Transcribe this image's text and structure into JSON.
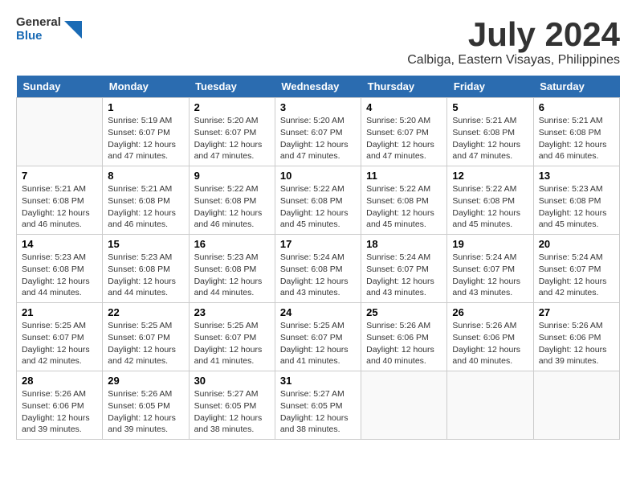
{
  "header": {
    "logo_general": "General",
    "logo_blue": "Blue",
    "month_year": "July 2024",
    "location": "Calbiga, Eastern Visayas, Philippines"
  },
  "days": [
    "Sunday",
    "Monday",
    "Tuesday",
    "Wednesday",
    "Thursday",
    "Friday",
    "Saturday"
  ],
  "weeks": [
    [
      {
        "date": "",
        "info": ""
      },
      {
        "date": "1",
        "info": "Sunrise: 5:19 AM\nSunset: 6:07 PM\nDaylight: 12 hours and 47 minutes."
      },
      {
        "date": "2",
        "info": "Sunrise: 5:20 AM\nSunset: 6:07 PM\nDaylight: 12 hours and 47 minutes."
      },
      {
        "date": "3",
        "info": "Sunrise: 5:20 AM\nSunset: 6:07 PM\nDaylight: 12 hours and 47 minutes."
      },
      {
        "date": "4",
        "info": "Sunrise: 5:20 AM\nSunset: 6:07 PM\nDaylight: 12 hours and 47 minutes."
      },
      {
        "date": "5",
        "info": "Sunrise: 5:21 AM\nSunset: 6:08 PM\nDaylight: 12 hours and 47 minutes."
      },
      {
        "date": "6",
        "info": "Sunrise: 5:21 AM\nSunset: 6:08 PM\nDaylight: 12 hours and 46 minutes."
      }
    ],
    [
      {
        "date": "7",
        "info": "Sunrise: 5:21 AM\nSunset: 6:08 PM\nDaylight: 12 hours and 46 minutes."
      },
      {
        "date": "8",
        "info": "Sunrise: 5:21 AM\nSunset: 6:08 PM\nDaylight: 12 hours and 46 minutes."
      },
      {
        "date": "9",
        "info": "Sunrise: 5:22 AM\nSunset: 6:08 PM\nDaylight: 12 hours and 46 minutes."
      },
      {
        "date": "10",
        "info": "Sunrise: 5:22 AM\nSunset: 6:08 PM\nDaylight: 12 hours and 45 minutes."
      },
      {
        "date": "11",
        "info": "Sunrise: 5:22 AM\nSunset: 6:08 PM\nDaylight: 12 hours and 45 minutes."
      },
      {
        "date": "12",
        "info": "Sunrise: 5:22 AM\nSunset: 6:08 PM\nDaylight: 12 hours and 45 minutes."
      },
      {
        "date": "13",
        "info": "Sunrise: 5:23 AM\nSunset: 6:08 PM\nDaylight: 12 hours and 45 minutes."
      }
    ],
    [
      {
        "date": "14",
        "info": "Sunrise: 5:23 AM\nSunset: 6:08 PM\nDaylight: 12 hours and 44 minutes."
      },
      {
        "date": "15",
        "info": "Sunrise: 5:23 AM\nSunset: 6:08 PM\nDaylight: 12 hours and 44 minutes."
      },
      {
        "date": "16",
        "info": "Sunrise: 5:23 AM\nSunset: 6:08 PM\nDaylight: 12 hours and 44 minutes."
      },
      {
        "date": "17",
        "info": "Sunrise: 5:24 AM\nSunset: 6:08 PM\nDaylight: 12 hours and 43 minutes."
      },
      {
        "date": "18",
        "info": "Sunrise: 5:24 AM\nSunset: 6:07 PM\nDaylight: 12 hours and 43 minutes."
      },
      {
        "date": "19",
        "info": "Sunrise: 5:24 AM\nSunset: 6:07 PM\nDaylight: 12 hours and 43 minutes."
      },
      {
        "date": "20",
        "info": "Sunrise: 5:24 AM\nSunset: 6:07 PM\nDaylight: 12 hours and 42 minutes."
      }
    ],
    [
      {
        "date": "21",
        "info": "Sunrise: 5:25 AM\nSunset: 6:07 PM\nDaylight: 12 hours and 42 minutes."
      },
      {
        "date": "22",
        "info": "Sunrise: 5:25 AM\nSunset: 6:07 PM\nDaylight: 12 hours and 42 minutes."
      },
      {
        "date": "23",
        "info": "Sunrise: 5:25 AM\nSunset: 6:07 PM\nDaylight: 12 hours and 41 minutes."
      },
      {
        "date": "24",
        "info": "Sunrise: 5:25 AM\nSunset: 6:07 PM\nDaylight: 12 hours and 41 minutes."
      },
      {
        "date": "25",
        "info": "Sunrise: 5:26 AM\nSunset: 6:06 PM\nDaylight: 12 hours and 40 minutes."
      },
      {
        "date": "26",
        "info": "Sunrise: 5:26 AM\nSunset: 6:06 PM\nDaylight: 12 hours and 40 minutes."
      },
      {
        "date": "27",
        "info": "Sunrise: 5:26 AM\nSunset: 6:06 PM\nDaylight: 12 hours and 39 minutes."
      }
    ],
    [
      {
        "date": "28",
        "info": "Sunrise: 5:26 AM\nSunset: 6:06 PM\nDaylight: 12 hours and 39 minutes."
      },
      {
        "date": "29",
        "info": "Sunrise: 5:26 AM\nSunset: 6:05 PM\nDaylight: 12 hours and 39 minutes."
      },
      {
        "date": "30",
        "info": "Sunrise: 5:27 AM\nSunset: 6:05 PM\nDaylight: 12 hours and 38 minutes."
      },
      {
        "date": "31",
        "info": "Sunrise: 5:27 AM\nSunset: 6:05 PM\nDaylight: 12 hours and 38 minutes."
      },
      {
        "date": "",
        "info": ""
      },
      {
        "date": "",
        "info": ""
      },
      {
        "date": "",
        "info": ""
      }
    ]
  ]
}
